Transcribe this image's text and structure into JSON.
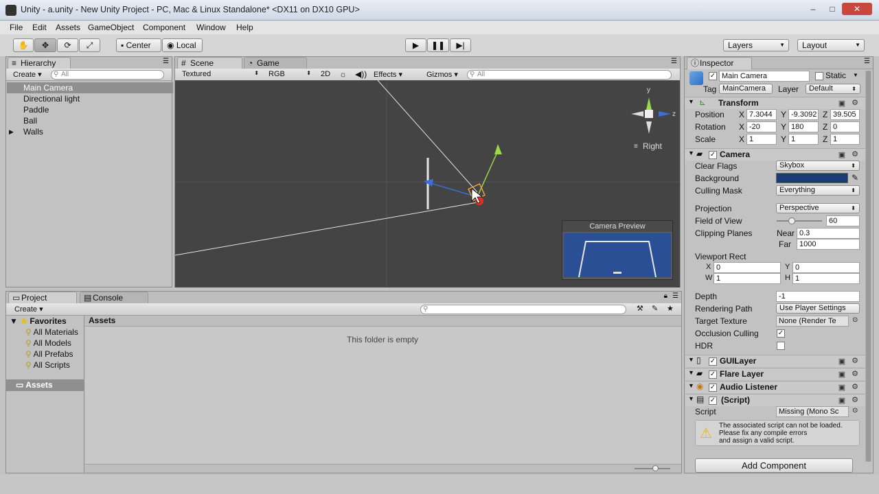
{
  "window": {
    "title": "Unity - a.unity - New Unity Project - PC, Mac & Linux Standalone* <DX11 on DX10 GPU>",
    "minimize": "–",
    "maximize": "□",
    "close": "✕"
  },
  "menu": [
    "File",
    "Edit",
    "Assets",
    "GameObject",
    "Component",
    "Window",
    "Help"
  ],
  "toolbar": {
    "pivot": "Center",
    "space": "Local",
    "layers": "Layers",
    "layout": "Layout"
  },
  "hierarchy": {
    "tab": "Hierarchy",
    "create": "Create",
    "search_placeholder": "All",
    "items": [
      "Main Camera",
      "Directional light",
      "Paddle",
      "Ball",
      "Walls"
    ]
  },
  "scene": {
    "tabs": [
      "Scene",
      "Game"
    ],
    "draw_mode": "Textured",
    "color_mode": "RGB",
    "mode_2d": "2D",
    "effects": "Effects",
    "gizmos": "Gizmos",
    "search_placeholder": "All",
    "gizmo_y": "y",
    "gizmo_z": "z",
    "gizmo_view": "Right",
    "camera_preview_title": "Camera Preview"
  },
  "inspector": {
    "tab": "Inspector",
    "object_name": "Main Camera",
    "static_label": "Static",
    "tag_label": "Tag",
    "tag_value": "MainCamera",
    "layer_label": "Layer",
    "layer_value": "Default",
    "transform": {
      "title": "Transform",
      "position_label": "Position",
      "position": [
        "7.3044",
        "-9.3092",
        "39.505"
      ],
      "rotation_label": "Rotation",
      "rotation": [
        "-20",
        "180",
        "0"
      ],
      "scale_label": "Scale",
      "scale": [
        "1",
        "1",
        "1"
      ],
      "x": "X",
      "y": "Y",
      "z": "Z"
    },
    "camera": {
      "title": "Camera",
      "clear_flags_label": "Clear Flags",
      "clear_flags": "Skybox",
      "background_label": "Background",
      "background_color": "#1a3a78",
      "culling_mask_label": "Culling Mask",
      "culling_mask": "Everything",
      "projection_label": "Projection",
      "projection": "Perspective",
      "fov_label": "Field of View",
      "fov": "60",
      "fov_fraction": 0.33,
      "clipping_label": "Clipping Planes",
      "near_label": "Near",
      "near": "0.3",
      "far_label": "Far",
      "far": "1000",
      "viewport_label": "Viewport Rect",
      "vx_label": "X",
      "vx": "0",
      "vy_label": "Y",
      "vy": "0",
      "vw_label": "W",
      "vw": "1",
      "vh_label": "H",
      "vh": "1",
      "depth_label": "Depth",
      "depth": "-1",
      "rendering_path_label": "Rendering Path",
      "rendering_path": "Use Player Settings",
      "target_texture_label": "Target Texture",
      "target_texture": "None (Render Te",
      "occlusion_label": "Occlusion Culling",
      "occlusion_checked": "✓",
      "hdr_label": "HDR"
    },
    "gui_layer": "GUILayer",
    "flare_layer": "Flare Layer",
    "audio_listener": "Audio Listener",
    "script_component": "(Script)",
    "script_label": "Script",
    "script_value": "Missing (Mono Sc",
    "warning_line1": "The associated script can not be loaded.",
    "warning_line2": "Please fix any compile errors",
    "warning_line3": "and assign a valid script.",
    "add_component": "Add Component"
  },
  "project": {
    "tabs": [
      "Project",
      "Console"
    ],
    "create": "Create",
    "favorites": "Favorites",
    "favorite_items": [
      "All Materials",
      "All Models",
      "All Prefabs",
      "All Scripts"
    ],
    "assets_folder": "Assets",
    "assets_header": "Assets",
    "empty_message": "This folder is empty"
  }
}
